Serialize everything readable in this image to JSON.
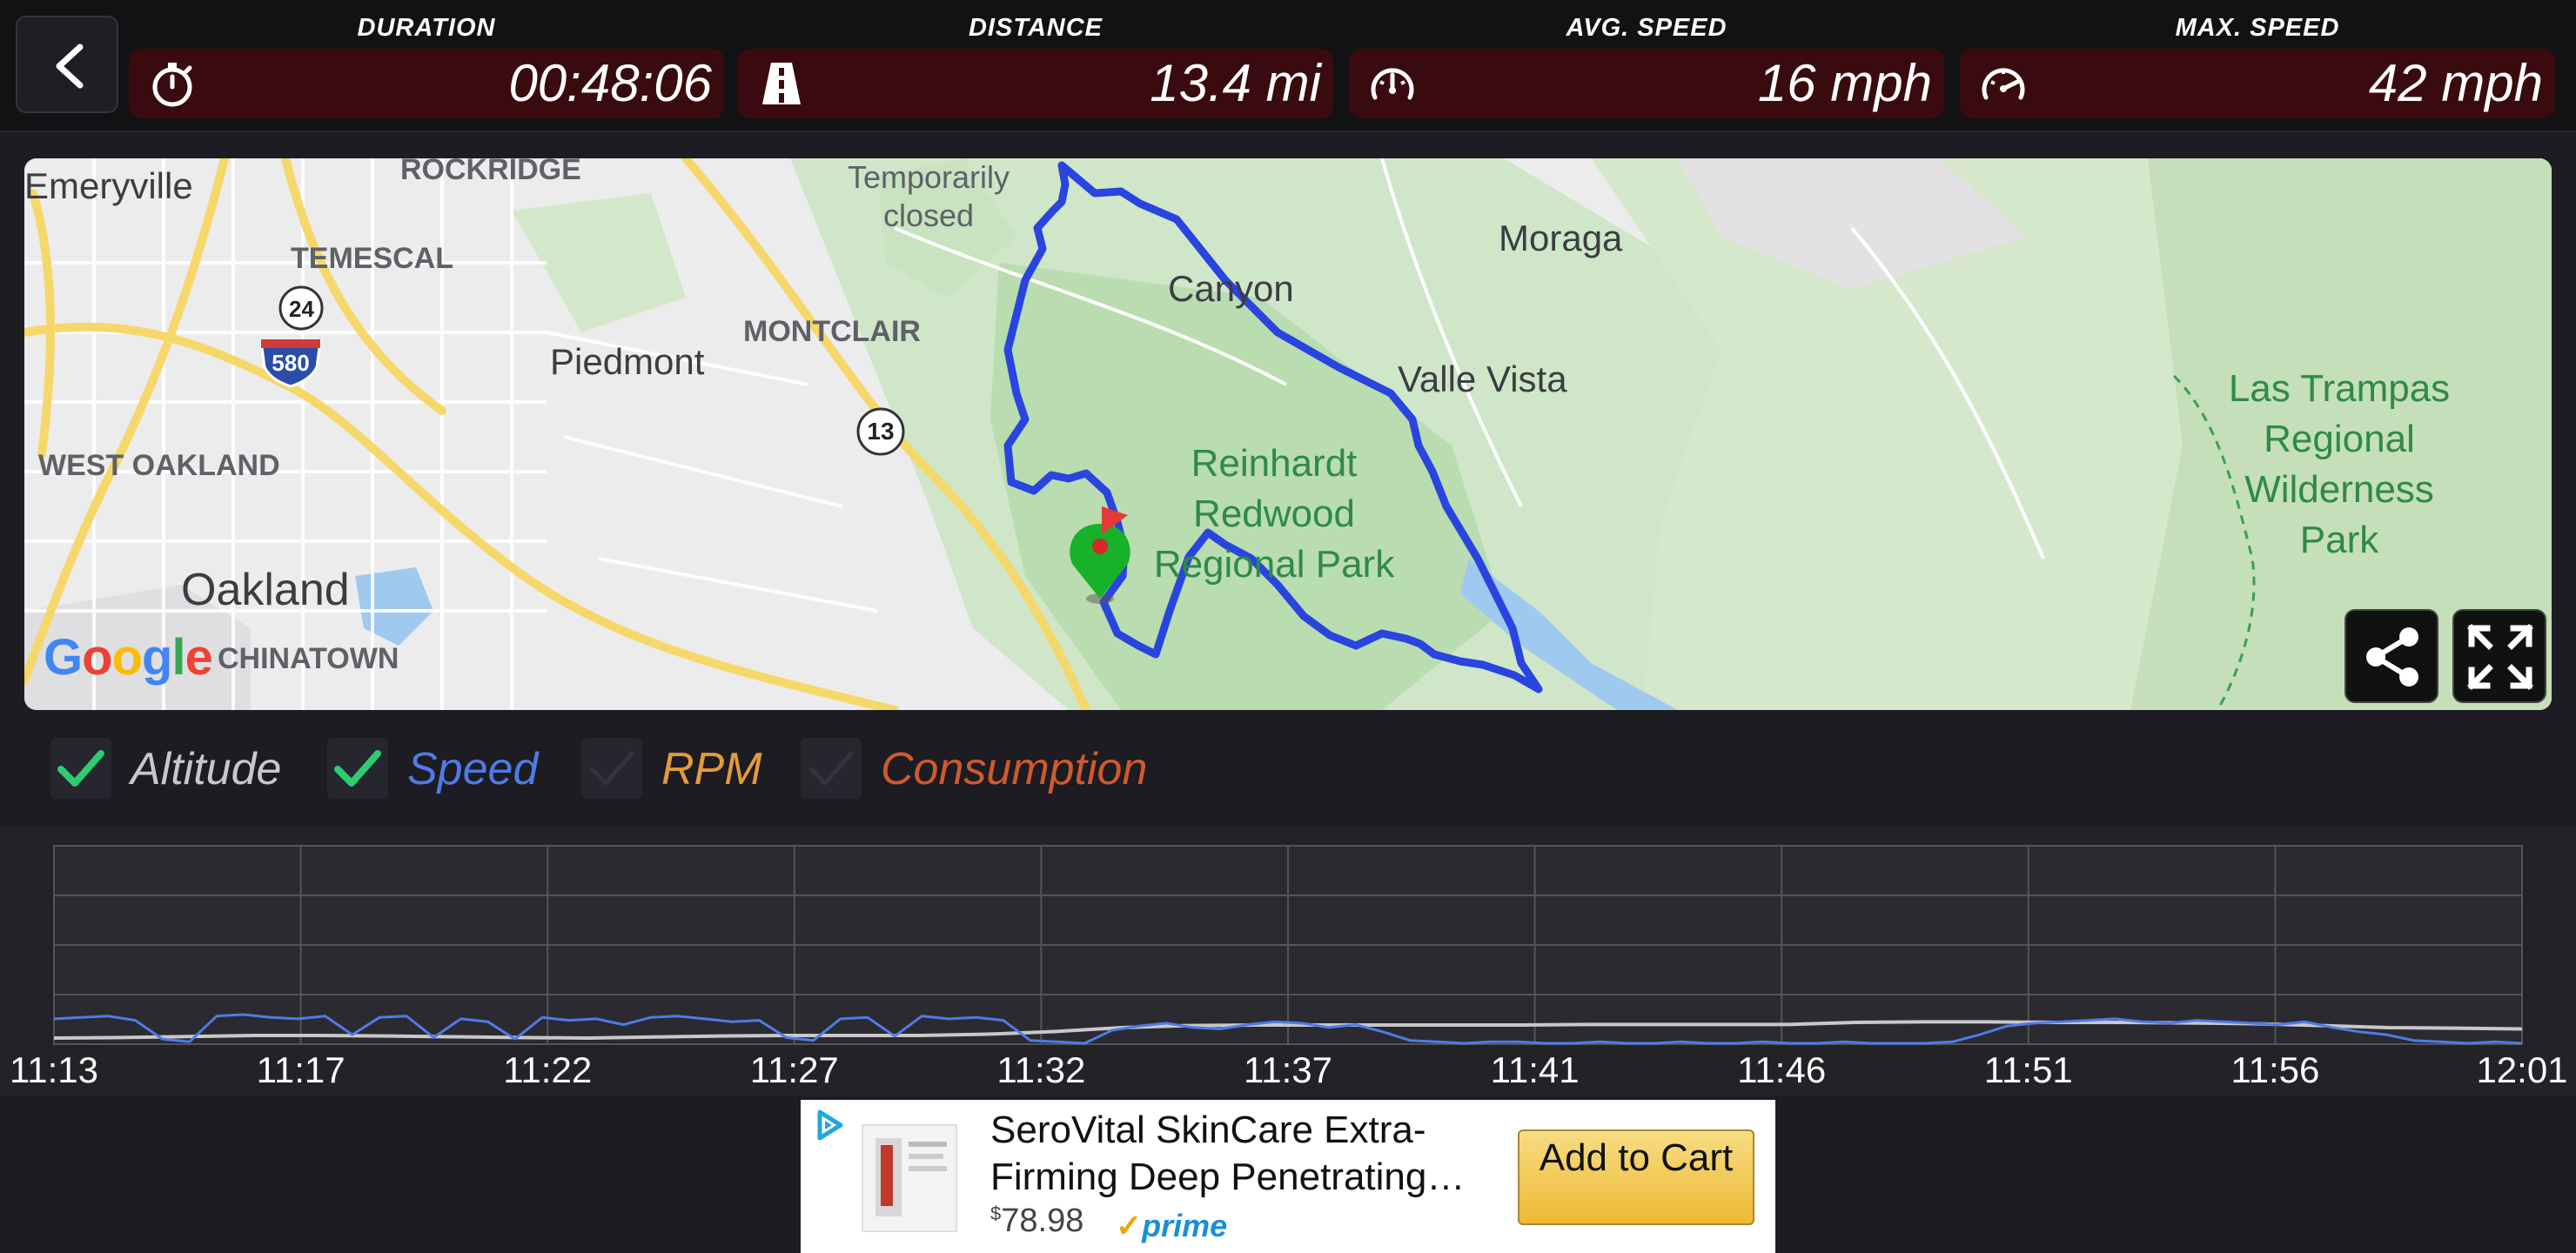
{
  "stats": {
    "duration": {
      "label": "DURATION",
      "value": "00:48:06",
      "icon": "stopwatch-icon"
    },
    "distance": {
      "label": "DISTANCE",
      "value": "13.4 mi",
      "icon": "road-icon"
    },
    "avg_speed": {
      "label": "AVG. SPEED",
      "value": "16 mph",
      "icon": "speedometer-icon"
    },
    "max_speed": {
      "label": "MAX. SPEED",
      "value": "42 mph",
      "icon": "speedometer-max-icon"
    }
  },
  "map": {
    "labels": {
      "emeryville": "Emeryville",
      "rockridge": "ROCKRIDGE",
      "temescal": "TEMESCAL",
      "piedmont": "Piedmont",
      "montclair": "MONTCLAIR",
      "west_oakland": "WEST OAKLAND",
      "oakland": "Oakland",
      "chinatown": "CHINATOWN",
      "temporarily_closed": "Temporarily closed",
      "canyon": "Canyon",
      "moraga": "Moraga",
      "valle_vista": "Valle Vista",
      "reinhardt_park": "Reinhardt Redwood Regional Park",
      "las_trampas": "Las Trampas Regional Wilderness Park",
      "route_24": "24",
      "route_580": "580",
      "route_13": "13"
    },
    "logo": "Google"
  },
  "toggles": [
    {
      "label": "Altitude",
      "checked": true,
      "color": "#c8c8c8"
    },
    {
      "label": "Speed",
      "checked": true,
      "color": "#4f7be6"
    },
    {
      "label": "RPM",
      "checked": false,
      "color": "#e59a3a"
    },
    {
      "label": "Consumption",
      "checked": false,
      "color": "#cf5a2e"
    }
  ],
  "chart_data": {
    "type": "line",
    "x_ticks": [
      "11:13",
      "11:17",
      "11:22",
      "11:27",
      "11:32",
      "11:37",
      "11:41",
      "11:46",
      "11:51",
      "11:56",
      "12:01"
    ],
    "series": [
      {
        "name": "Altitude",
        "color": "#c8c8c8",
        "values": [
          0.2,
          0.22,
          0.26,
          0.3,
          0.3,
          0.28,
          0.25,
          0.22,
          0.2,
          0.24,
          0.28,
          0.3,
          0.3,
          0.3,
          0.35,
          0.45,
          0.6,
          0.68,
          0.7,
          0.7,
          0.7,
          0.7,
          0.7,
          0.72,
          0.72,
          0.72,
          0.72,
          0.8,
          0.82,
          0.82,
          0.8,
          0.8,
          0.78,
          0.75,
          0.68,
          0.6,
          0.58,
          0.55
        ]
      },
      {
        "name": "Speed",
        "color": "#4f7be6",
        "values": [
          0.85,
          0.9,
          0.95,
          0.8,
          0.15,
          0.05,
          0.95,
          1.0,
          0.9,
          0.85,
          0.95,
          0.3,
          0.9,
          0.95,
          0.2,
          0.85,
          0.75,
          0.15,
          0.9,
          0.8,
          0.85,
          0.65,
          0.9,
          0.95,
          0.85,
          0.75,
          0.8,
          0.2,
          0.1,
          0.85,
          0.9,
          0.25,
          0.95,
          0.85,
          0.9,
          0.8,
          0.1,
          0.05,
          0.0,
          0.45,
          0.6,
          0.7,
          0.55,
          0.5,
          0.65,
          0.75,
          0.7,
          0.55,
          0.65,
          0.4,
          0.1,
          0.05,
          0.0,
          0.05,
          0.05,
          0.0,
          0.0,
          0.05,
          0.0,
          0.0,
          0.05,
          0.0,
          0.0,
          0.05,
          0.0,
          0.0,
          0.05,
          0.0,
          0.0,
          0.0,
          0.05,
          0.3,
          0.6,
          0.7,
          0.75,
          0.8,
          0.85,
          0.75,
          0.7,
          0.8,
          0.75,
          0.7,
          0.65,
          0.75,
          0.55,
          0.4,
          0.3,
          0.1,
          0.05,
          0.0,
          0.05,
          0.0
        ]
      }
    ]
  },
  "ad": {
    "title": "SeroVital SkinCare Extra-Firming Deep Penetrating…",
    "price_currency": "$",
    "price": "78.98",
    "prime": "prime",
    "cart_label": "Add to Cart"
  },
  "colors": {
    "stat_box": "#3a0b0e",
    "route": "#2a44e0",
    "toggle_check": "#2ecc71"
  }
}
